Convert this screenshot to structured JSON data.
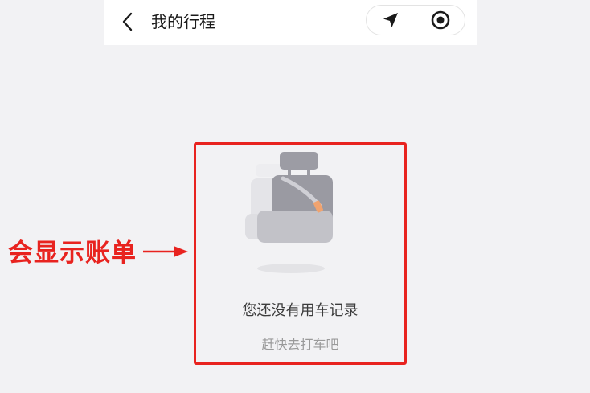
{
  "nav": {
    "title": "我的行程",
    "back_icon": "chevron-left-icon",
    "location_icon": "navigation-arrow-icon",
    "target_icon": "target-circle-icon"
  },
  "empty_state": {
    "illustration": "car-seat-icon",
    "title": "您还没有用车记录",
    "subtitle": "赶快去打车吧"
  },
  "annotation": {
    "text": "会显示账单",
    "color": "#e8231f"
  }
}
